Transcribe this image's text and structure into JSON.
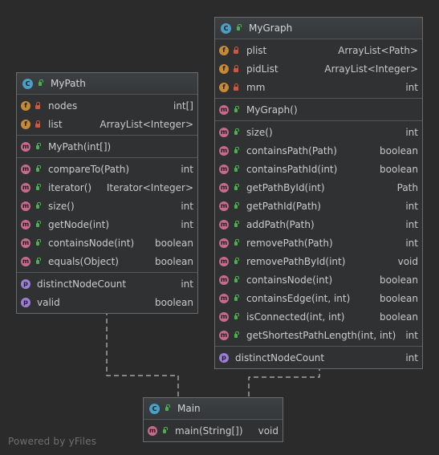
{
  "footer": "Powered by yFiles",
  "classes": {
    "mypath": {
      "name": "MyPath",
      "fields": [
        {
          "icon": "f",
          "vis": "priv",
          "name": "nodes",
          "type": "int[]"
        },
        {
          "icon": "f",
          "vis": "priv",
          "name": "list",
          "type": "ArrayList<Integer>"
        }
      ],
      "constructors": [
        {
          "icon": "m",
          "vis": "pub",
          "name": "MyPath(int[])",
          "type": ""
        }
      ],
      "methods": [
        {
          "icon": "m",
          "vis": "pub",
          "name": "compareTo(Path)",
          "type": "int"
        },
        {
          "icon": "m",
          "vis": "pub",
          "name": "iterator()",
          "type": "Iterator<Integer>"
        },
        {
          "icon": "m",
          "vis": "pub",
          "name": "size()",
          "type": "int"
        },
        {
          "icon": "m",
          "vis": "pub",
          "name": "getNode(int)",
          "type": "int"
        },
        {
          "icon": "m",
          "vis": "pub",
          "name": "containsNode(int)",
          "type": "boolean"
        },
        {
          "icon": "m",
          "vis": "pub",
          "name": "equals(Object)",
          "type": "boolean"
        }
      ],
      "properties": [
        {
          "icon": "p",
          "vis": "none",
          "name": "distinctNodeCount",
          "type": "int"
        },
        {
          "icon": "p",
          "vis": "none",
          "name": "valid",
          "type": "boolean"
        }
      ]
    },
    "mygraph": {
      "name": "MyGraph",
      "fields": [
        {
          "icon": "f",
          "vis": "priv",
          "name": "plist",
          "type": "ArrayList<Path>"
        },
        {
          "icon": "f",
          "vis": "priv",
          "name": "pidList",
          "type": "ArrayList<Integer>"
        },
        {
          "icon": "f",
          "vis": "priv",
          "name": "mm",
          "type": "int"
        }
      ],
      "constructors": [
        {
          "icon": "m",
          "vis": "pub",
          "name": "MyGraph()",
          "type": ""
        }
      ],
      "methods": [
        {
          "icon": "m",
          "vis": "pub",
          "name": "size()",
          "type": "int"
        },
        {
          "icon": "m",
          "vis": "pub",
          "name": "containsPath(Path)",
          "type": "boolean"
        },
        {
          "icon": "m",
          "vis": "pub",
          "name": "containsPathId(int)",
          "type": "boolean"
        },
        {
          "icon": "m",
          "vis": "pub",
          "name": "getPathById(int)",
          "type": "Path"
        },
        {
          "icon": "m",
          "vis": "pub",
          "name": "getPathId(Path)",
          "type": "int"
        },
        {
          "icon": "m",
          "vis": "pub",
          "name": "addPath(Path)",
          "type": "int"
        },
        {
          "icon": "m",
          "vis": "pub",
          "name": "removePath(Path)",
          "type": "int"
        },
        {
          "icon": "m",
          "vis": "pub",
          "name": "removePathById(int)",
          "type": "void"
        },
        {
          "icon": "m",
          "vis": "pub",
          "name": "containsNode(int)",
          "type": "boolean"
        },
        {
          "icon": "m",
          "vis": "pub",
          "name": "containsEdge(int, int)",
          "type": "boolean"
        },
        {
          "icon": "m",
          "vis": "pub",
          "name": "isConnected(int, int)",
          "type": "boolean"
        },
        {
          "icon": "m",
          "vis": "pub",
          "name": "getShortestPathLength(int, int)",
          "type": "int"
        }
      ],
      "properties": [
        {
          "icon": "p",
          "vis": "none",
          "name": "distinctNodeCount",
          "type": "int"
        }
      ]
    },
    "main": {
      "name": "Main",
      "fields": [],
      "constructors": [],
      "methods": [
        {
          "icon": "m",
          "vis": "pub",
          "name": "main(String[])",
          "type": "void"
        }
      ],
      "properties": []
    }
  },
  "colors": {
    "method": "#c86b8a",
    "field": "#c68a37",
    "property": "#9b7ed6",
    "class": "#4aa0c4",
    "public": "#4caf50",
    "private": "#d0563f"
  }
}
